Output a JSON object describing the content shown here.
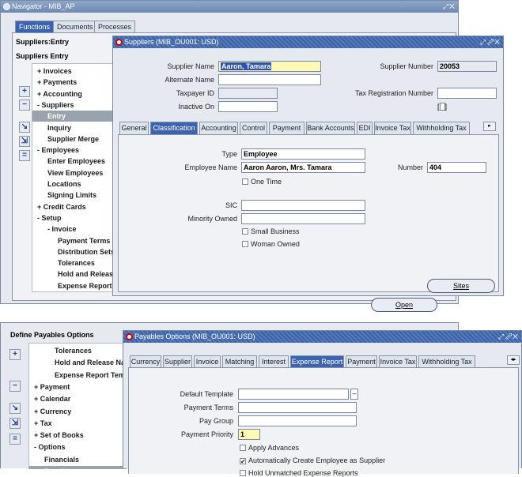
{
  "navigator": {
    "title": "Navigator - MIB_AP",
    "tabs": [
      "Functions",
      "Documents",
      "Processes"
    ],
    "heading1": "Suppliers:Entry",
    "heading2": "Suppliers Entry",
    "tree": [
      {
        "label": "+ Invoices",
        "indent": 0
      },
      {
        "label": "+ Payments",
        "indent": 0
      },
      {
        "label": "+ Accounting",
        "indent": 0
      },
      {
        "label": "- Suppliers",
        "indent": 0
      },
      {
        "label": "Entry",
        "indent": 1,
        "selected": true
      },
      {
        "label": "Inquiry",
        "indent": 1
      },
      {
        "label": "Supplier Merge",
        "indent": 1
      },
      {
        "label": "- Employees",
        "indent": 0
      },
      {
        "label": "Enter Employees",
        "indent": 1
      },
      {
        "label": "View Employees",
        "indent": 1
      },
      {
        "label": "Locations",
        "indent": 1
      },
      {
        "label": "Signing Limits",
        "indent": 1
      },
      {
        "label": "+ Credit Cards",
        "indent": 0
      },
      {
        "label": "- Setup",
        "indent": 0
      },
      {
        "label": "- Invoice",
        "indent": 1
      },
      {
        "label": "Payment Terms",
        "indent": 2
      },
      {
        "label": "Distribution Sets",
        "indent": 2
      },
      {
        "label": "Tolerances",
        "indent": 2
      },
      {
        "label": "Hold and Release",
        "indent": 2
      },
      {
        "label": "Expense Report T",
        "indent": 2
      }
    ],
    "open_button": "Open"
  },
  "suppliers": {
    "title": "Suppliers (MIB_OU001: USD)",
    "supplier_name_label": "Supplier Name",
    "supplier_name": "Aaron, Tamara",
    "alternate_name_label": "Alternate Name",
    "taxpayer_id_label": "Taxpayer ID",
    "inactive_on_label": "Inactive On",
    "supplier_number_label": "Supplier Number",
    "supplier_number": "20053",
    "tax_reg_label": "Tax Registration Number",
    "tabs": [
      "General",
      "Classification",
      "Accounting",
      "Control",
      "Payment",
      "Bank Accounts",
      "EDI",
      "Invoice Tax",
      "Withholding Tax"
    ],
    "active_tab": "Classification",
    "type_label": "Type",
    "type_value": "Employee",
    "employee_name_label": "Employee Name",
    "employee_name": "Aaron Aaron, Mrs. Tamara",
    "number_label": "Number",
    "number_value": "404",
    "one_time_label": "One Time",
    "sic_label": "SIC",
    "minority_owned_label": "Minority Owned",
    "small_business_label": "Small Business",
    "woman_owned_label": "Woman Owned",
    "sites_button": "Sites"
  },
  "define_payables": {
    "heading": "Define Payables Options",
    "tree": [
      {
        "label": "Tolerances",
        "indent": 2
      },
      {
        "label": "Hold and Release Nar",
        "indent": 2
      },
      {
        "label": "Expense Report Temp",
        "indent": 2
      },
      {
        "label": "+ Payment",
        "indent": 0
      },
      {
        "label": "+ Calendar",
        "indent": 0
      },
      {
        "label": "+ Currency",
        "indent": 0
      },
      {
        "label": "+ Tax",
        "indent": 0
      },
      {
        "label": "+ Set of Books",
        "indent": 0
      },
      {
        "label": "- Options",
        "indent": 0
      },
      {
        "label": "Financials",
        "indent": 1
      },
      {
        "label": "Payables",
        "indent": 1,
        "selected": true
      }
    ]
  },
  "payables_options": {
    "title": "Payables Options (MIB_OU001: USD)",
    "tabs": [
      "Currency",
      "Supplier",
      "Invoice",
      "Matching",
      "Interest",
      "Expense Report",
      "Payment",
      "Invoice Tax",
      "Withholding Tax"
    ],
    "active_tab": "Expense Report",
    "default_template_label": "Default Template",
    "payment_terms_label": "Payment Terms",
    "pay_group_label": "Pay Group",
    "payment_priority_label": "Payment Priority",
    "payment_priority": "1",
    "apply_advances_label": "Apply Advances",
    "apply_advances": false,
    "auto_create_label": "Automatically Create Employee as Supplier",
    "auto_create": true,
    "hold_unmatched_label": "Hold Unmatched Expense Reports"
  }
}
